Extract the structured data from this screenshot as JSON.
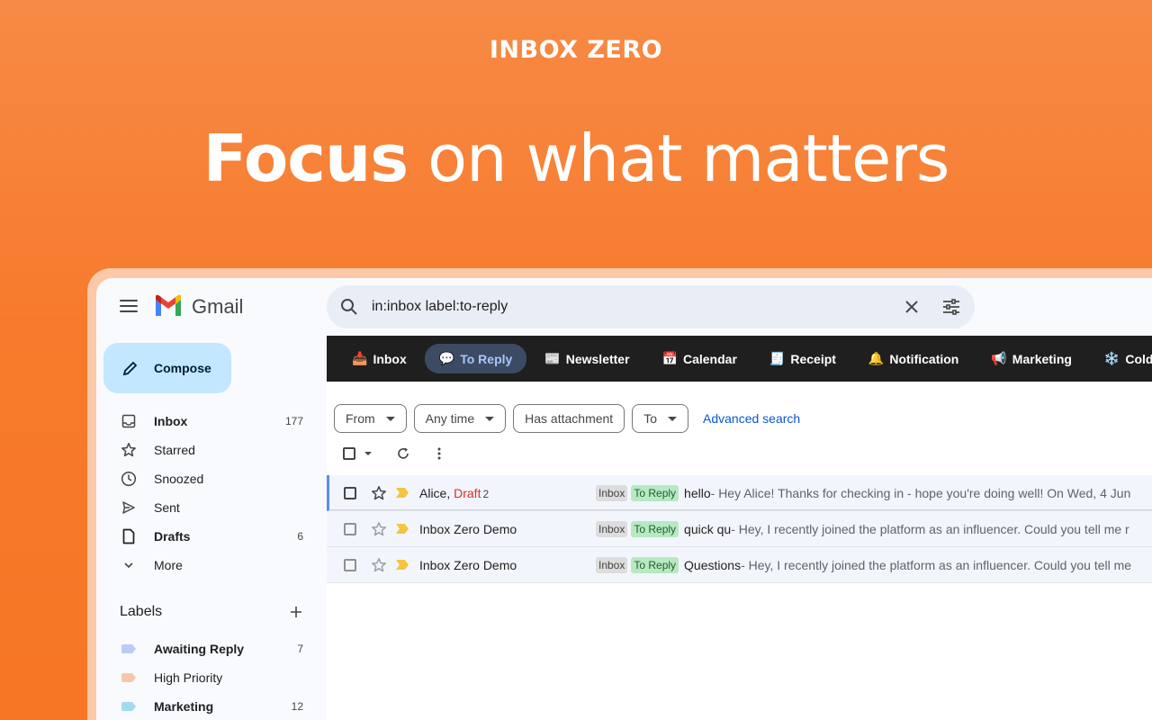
{
  "brand": "INBOX ZERO",
  "headline": {
    "bold": "Focus",
    "light": " on what matters"
  },
  "app": {
    "name": "Gmail",
    "compose_label": "Compose"
  },
  "nav": [
    {
      "label": "Inbox",
      "count": "177",
      "icon": "inbox-icon",
      "bold": true
    },
    {
      "label": "Starred",
      "count": "",
      "icon": "star-icon",
      "bold": false
    },
    {
      "label": "Snoozed",
      "count": "",
      "icon": "clock-icon",
      "bold": false
    },
    {
      "label": "Sent",
      "count": "",
      "icon": "send-icon",
      "bold": false
    },
    {
      "label": "Drafts",
      "count": "6",
      "icon": "draft-file-icon",
      "bold": true
    },
    {
      "label": "More",
      "count": "",
      "icon": "chevron-down-icon",
      "bold": false
    }
  ],
  "labels_heading": "Labels",
  "labels": [
    {
      "label": "Awaiting Reply",
      "count": "7",
      "color": "#b9cdf5",
      "bold": true
    },
    {
      "label": "High Priority",
      "count": "",
      "color": "#f7c7ad",
      "bold": false
    },
    {
      "label": "Marketing",
      "count": "12",
      "color": "#9fdcf0",
      "bold": true
    }
  ],
  "search": {
    "query": "in:inbox label:to-reply"
  },
  "tabs": [
    {
      "emoji": "📥",
      "label": "Inbox",
      "active": false
    },
    {
      "emoji": "💬",
      "label": "To Reply",
      "active": true
    },
    {
      "emoji": "📰",
      "label": "Newsletter",
      "active": false
    },
    {
      "emoji": "📅",
      "label": "Calendar",
      "active": false
    },
    {
      "emoji": "🧾",
      "label": "Receipt",
      "active": false
    },
    {
      "emoji": "🔔",
      "label": "Notification",
      "active": false
    },
    {
      "emoji": "📢",
      "label": "Marketing",
      "active": false
    },
    {
      "emoji": "❄️",
      "label": "Cold",
      "active": false
    }
  ],
  "filters": [
    {
      "label": "From",
      "dropdown": true
    },
    {
      "label": "Any time",
      "dropdown": true
    },
    {
      "label": "Has attachment",
      "dropdown": false
    },
    {
      "label": "To",
      "dropdown": true
    }
  ],
  "advanced_search": "Advanced search",
  "emails": [
    {
      "sender": "Alice, ",
      "draft": "Draft",
      "count": "2",
      "tag1": "Inbox",
      "tag2": "To Reply",
      "subject": "hello",
      "snippet": " - Hey Alice! Thanks for checking in - hope you're doing well! On Wed, 4 Jun"
    },
    {
      "sender": "Inbox Zero Demo",
      "draft": "",
      "count": "",
      "tag1": "Inbox",
      "tag2": "To Reply",
      "subject": "quick qu",
      "snippet": " - Hey, I recently joined the platform as an influencer. Could you tell me r"
    },
    {
      "sender": "Inbox Zero Demo",
      "draft": "",
      "count": "",
      "tag1": "Inbox",
      "tag2": "To Reply",
      "subject": "Questions",
      "snippet": " - Hey, I recently joined the platform as an influencer. Could you tell me"
    }
  ]
}
